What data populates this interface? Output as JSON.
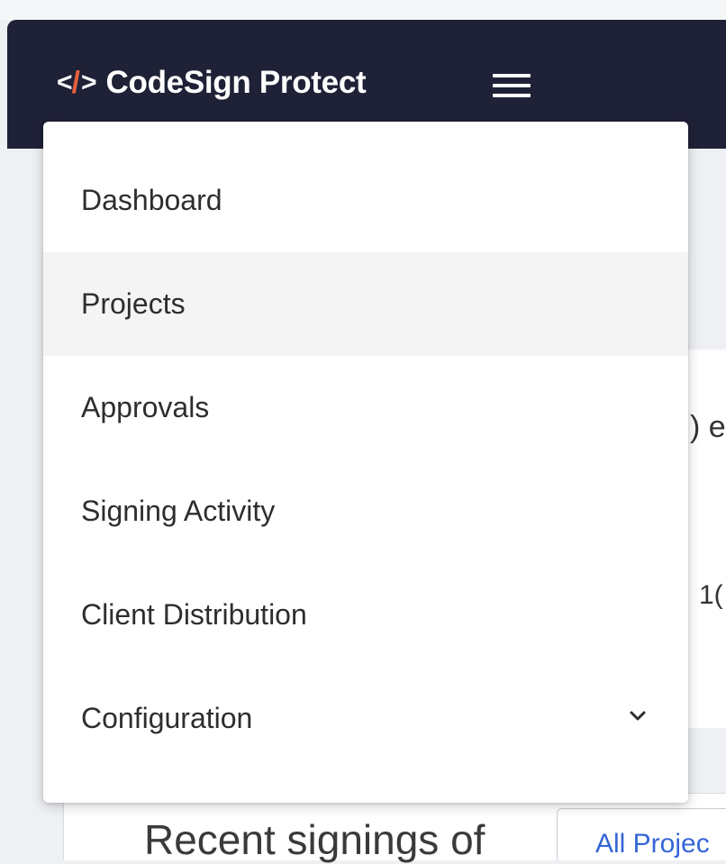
{
  "app": {
    "logo_glyph_left": "<",
    "logo_glyph_slash": "/",
    "logo_glyph_right": ">",
    "title": "CodeSign Protect"
  },
  "menu": {
    "items": [
      {
        "label": "Dashboard"
      },
      {
        "label": "Projects"
      },
      {
        "label": "Approvals"
      },
      {
        "label": "Signing Activity"
      },
      {
        "label": "Client Distribution"
      },
      {
        "label": "Configuration"
      }
    ],
    "expand_icon": "chevron-down-icon"
  },
  "background": {
    "peek_1": ") e",
    "peek_2": "1(",
    "recent_label": "Recent signings of",
    "project_filter": "All Projec"
  },
  "colors": {
    "header_bg": "#1f2137",
    "accent": "#e8603c",
    "link": "#3566d6"
  }
}
